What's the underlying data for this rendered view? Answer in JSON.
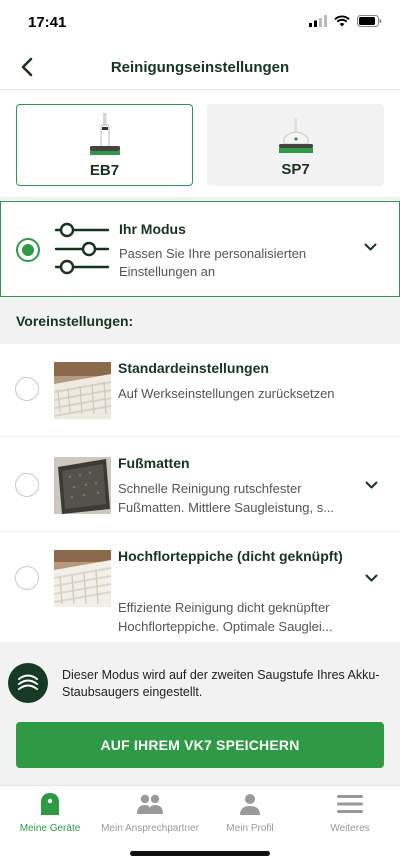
{
  "status_bar": {
    "time": "17:41"
  },
  "header": {
    "title": "Reinigungseinstellungen"
  },
  "devices": [
    {
      "label": "EB7",
      "selected": true
    },
    {
      "label": "SP7",
      "selected": false
    }
  ],
  "mode": {
    "title": "Ihr Modus",
    "description": "Passen Sie Ihre personalisierten Einstellungen an",
    "selected": true
  },
  "presets_label": "Voreinstellungen:",
  "presets": [
    {
      "title": "Standardeinstellungen",
      "description": "Auf Werkseinstellungen zurücksetzen"
    },
    {
      "title": "Fußmatten",
      "description": "Schnelle Reinigung rutschfester Fußmatten. Mittlere Saugleistung, s..."
    },
    {
      "title": "Hochflorteppiche (dicht geknüpft)",
      "description": "Effiziente Reinigung dicht geknüpfter Hochflorteppiche. Optimale Sauglei..."
    }
  ],
  "info": {
    "text": "Dieser Modus wird auf der zweiten Saugstufe Ihres Akku-Staubsaugers eingestellt."
  },
  "save_button": {
    "label": "AUF IHREM VK7 SPEICHERN"
  },
  "tabbar": {
    "items": [
      {
        "label": "Meine Geräte",
        "icon": "home-icon",
        "active": true
      },
      {
        "label": "Mein Ansprechpartner",
        "icon": "people-icon",
        "active": false
      },
      {
        "label": "Mein Profil",
        "icon": "profile-icon",
        "active": false
      },
      {
        "label": "Weiteres",
        "icon": "menu-icon",
        "active": false
      }
    ]
  },
  "colors": {
    "accent": "#2e9a46",
    "dark_green": "#16351f",
    "info_icon_bg": "#173a27"
  }
}
